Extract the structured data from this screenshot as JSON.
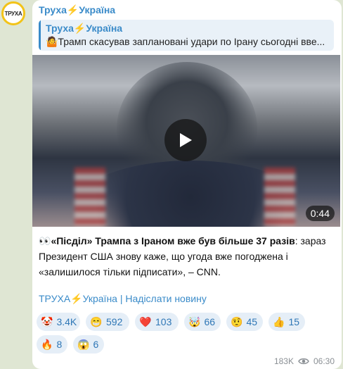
{
  "channel": {
    "avatar_text": "ТРУХА",
    "name_prefix": "Труха",
    "bolt": "⚡",
    "name_suffix": "Україна"
  },
  "reply": {
    "title_prefix": "Труха",
    "bolt": "⚡",
    "title_suffix": "Україна",
    "text": "🤷Трамп скасував заплановані удари по Ірану сьогодні вве..."
  },
  "video": {
    "duration": "0:44"
  },
  "post": {
    "eyes": "👀",
    "bold_text": "«Пісділ» Трампа з Іраном вже був більше 37 разів",
    "rest_text": ": зараз Президент США знову каже, що угода вже погоджена і «залишилося тільки підписати», – CNN."
  },
  "footer_link": {
    "prefix": "ТРУХА",
    "bolt": "⚡",
    "suffix": "Україна | Надіслати новину"
  },
  "reactions": [
    {
      "emoji": "🤡",
      "count": "3.4K",
      "icon": "clown-icon"
    },
    {
      "emoji": "😁",
      "count": "592",
      "icon": "grin-icon"
    },
    {
      "emoji": "❤️",
      "count": "103",
      "icon": "heart-icon"
    },
    {
      "emoji": "🤯",
      "count": "66",
      "icon": "mind-blown-icon"
    },
    {
      "emoji": "🤨",
      "count": "45",
      "icon": "raised-eyebrow-icon"
    },
    {
      "emoji": "👍",
      "count": "15",
      "icon": "thumbs-up-icon"
    },
    {
      "emoji": "🔥",
      "count": "8",
      "icon": "fire-icon"
    },
    {
      "emoji": "😱",
      "count": "6",
      "icon": "scream-icon"
    }
  ],
  "meta": {
    "views": "183K",
    "time": "06:30"
  },
  "colors": {
    "accent": "#3a8bc9",
    "bolt": "#f2b705",
    "reaction_bg": "#e5eef7"
  }
}
